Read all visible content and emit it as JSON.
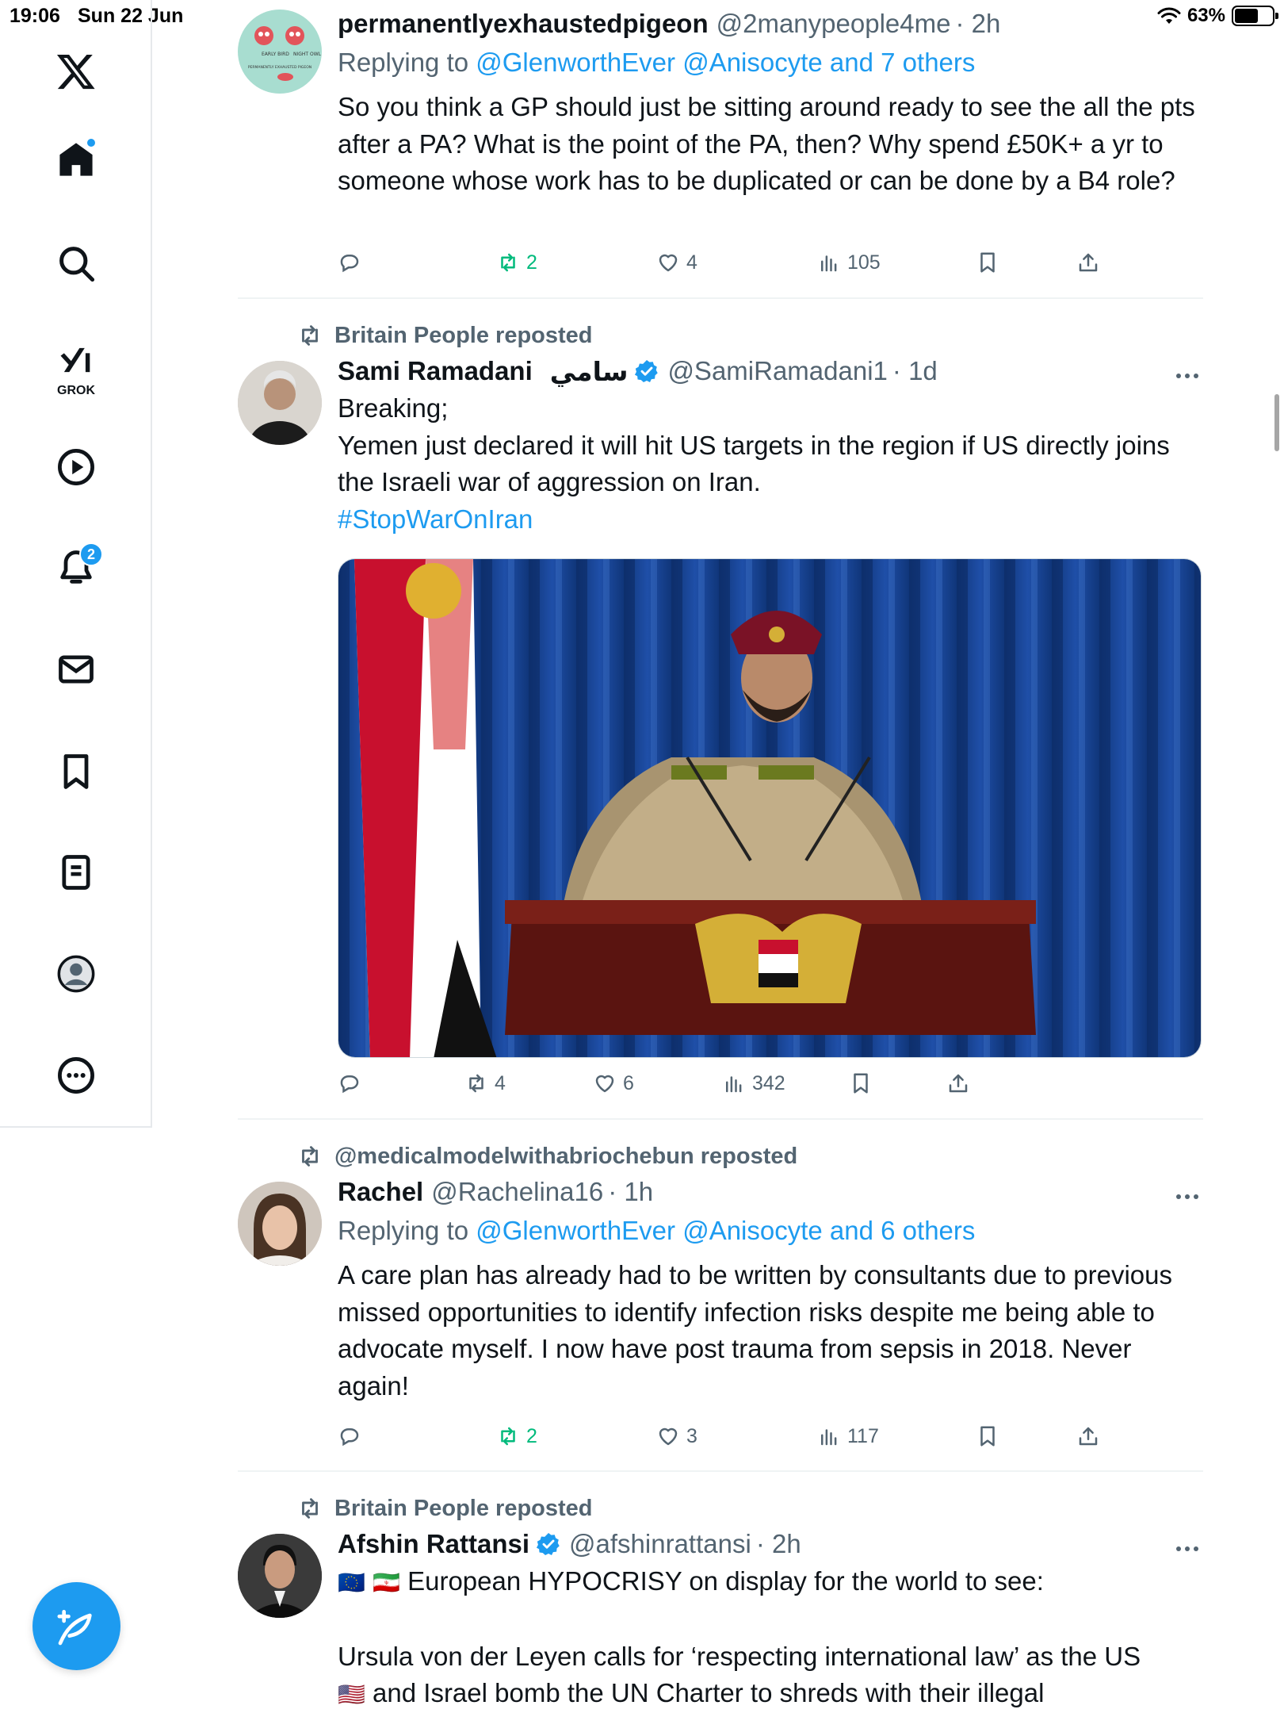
{
  "status_bar": {
    "time": "19:06",
    "date": "Sun 22 Jun",
    "battery": "63%",
    "battery_level": 0.63
  },
  "sidebar": {
    "items": [
      {
        "name": "logo",
        "icon": "x-logo-icon"
      },
      {
        "name": "home",
        "icon": "home-icon",
        "has_dot": true
      },
      {
        "name": "explore",
        "icon": "search-icon"
      },
      {
        "name": "grok",
        "icon": "grok-icon",
        "label": "GROK"
      },
      {
        "name": "video",
        "icon": "play-icon"
      },
      {
        "name": "notifications",
        "icon": "bell-icon",
        "badge": "2"
      },
      {
        "name": "messages",
        "icon": "mail-icon"
      },
      {
        "name": "bookmarks",
        "icon": "bookmark-icon"
      },
      {
        "name": "lists",
        "icon": "list-icon"
      },
      {
        "name": "profile",
        "icon": "profile-icon"
      },
      {
        "name": "more",
        "icon": "more-circle-icon"
      }
    ],
    "compose_icon": "compose-feather-icon"
  },
  "posts": [
    {
      "name": "permanentlyexhaustedpigeon",
      "handle": "@2manypeople4me",
      "time": "· 2h",
      "reply_prefix": "Replying to ",
      "reply_targets": "@GlenworthEver @Anisocyte and 7 others",
      "text": "So you think a GP should just be sitting around ready to see the all the pts after a PA? What is the point of the PA, then? Why spend £50K+ a yr to someone whose work has to be duplicated or can be done by a B4 role?",
      "reposts": "2",
      "likes": "4",
      "views": "105",
      "avatar_text": {
        "a": "EARLY BIRD",
        "b": "NIGHT OWL",
        "c": "PERMANENTLY EXHAUSTED PIGEON"
      }
    },
    {
      "reposted_by": "Britain People reposted",
      "name": "Sami Ramadani",
      "name_arabic": "سامي",
      "verified": true,
      "handle": "@SamiRamadani1",
      "time": "· 1d",
      "lines": [
        "Breaking;",
        "Yemen just declared it will hit US targets in the region if US directly joins the Israeli war of aggression on Iran."
      ],
      "hashtag": "#StopWarOnIran",
      "reposts": "4",
      "likes": "6",
      "views": "342"
    },
    {
      "reposted_by": "@medicalmodelwithabriochebun reposted",
      "name": "Rachel",
      "handle": "@Rachelina16",
      "time": "· 1h",
      "reply_prefix": "Replying to ",
      "reply_targets": "@GlenworthEver @Anisocyte and 6 others",
      "text": "A care plan has already had to be written by consultants due to previous missed opportunities to identify infection risks despite me being able to advocate myself. I now have post trauma from sepsis in 2018. Never again!",
      "reposts": "2",
      "likes": "3",
      "views": "117"
    },
    {
      "reposted_by": "Britain People reposted",
      "name": "Afshin Rattansi",
      "verified": true,
      "handle": "@afshinrattansi",
      "time": "· 2h",
      "flag_1": "🇪🇺",
      "flag_2": "🇮🇷",
      "line1": "European HYPOCRISY on display for the world to see:",
      "line2": "Ursula von der Leyen calls for ‘respecting international law’ as the US",
      "flag_3": "🇺🇸",
      "line3": "and Israel bomb the UN Charter to shreds with their illegal"
    }
  ],
  "colors": {
    "accent": "#1d9bf0",
    "repost_active": "#00ba7c",
    "muted": "#536471",
    "text": "#0f1419"
  }
}
